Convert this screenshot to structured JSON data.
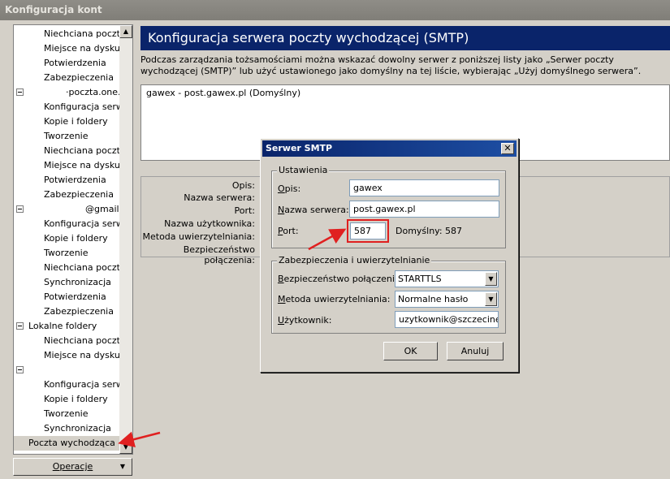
{
  "window": {
    "title": "Konfiguracja kont"
  },
  "sidebar": {
    "items": [
      {
        "label": "Niechciana poczta",
        "indent": 2,
        "expander": false
      },
      {
        "label": "Miejsce na dysku",
        "indent": 2,
        "expander": false
      },
      {
        "label": "Potwierdzenia",
        "indent": 2,
        "expander": false
      },
      {
        "label": "Zabezpieczenia",
        "indent": 2,
        "expander": false
      },
      {
        "label": "·poczta.one...",
        "indent": 3,
        "expander": true
      },
      {
        "label": "Konfiguracja serw...",
        "indent": 2,
        "expander": false
      },
      {
        "label": "Kopie i foldery",
        "indent": 2,
        "expander": false
      },
      {
        "label": "Tworzenie",
        "indent": 2,
        "expander": false
      },
      {
        "label": "Niechciana poczta",
        "indent": 2,
        "expander": false
      },
      {
        "label": "Miejsce na dysku",
        "indent": 2,
        "expander": false
      },
      {
        "label": "Potwierdzenia",
        "indent": 2,
        "expander": false
      },
      {
        "label": "Zabezpieczenia",
        "indent": 2,
        "expander": false
      },
      {
        "label": "@gmail.com",
        "indent": 4,
        "expander": true
      },
      {
        "label": "Konfiguracja serw...",
        "indent": 2,
        "expander": false
      },
      {
        "label": "Kopie i foldery",
        "indent": 2,
        "expander": false
      },
      {
        "label": "Tworzenie",
        "indent": 2,
        "expander": false
      },
      {
        "label": "Niechciana poczta",
        "indent": 2,
        "expander": false
      },
      {
        "label": "Synchronizacja",
        "indent": 2,
        "expander": false
      },
      {
        "label": "Potwierdzenia",
        "indent": 2,
        "expander": false
      },
      {
        "label": "Zabezpieczenia",
        "indent": 2,
        "expander": false
      },
      {
        "label": "Lokalne foldery",
        "indent": 1,
        "expander": true
      },
      {
        "label": "Niechciana poczta",
        "indent": 2,
        "expander": false
      },
      {
        "label": "Miejsce na dysku",
        "indent": 2,
        "expander": false
      },
      {
        "label": "",
        "indent": 1,
        "expander": true
      },
      {
        "label": "Konfiguracja serw...",
        "indent": 2,
        "expander": false
      },
      {
        "label": "Kopie i foldery",
        "indent": 2,
        "expander": false
      },
      {
        "label": "Tworzenie",
        "indent": 2,
        "expander": false
      },
      {
        "label": "Synchronizacja",
        "indent": 2,
        "expander": false
      },
      {
        "label": "Poczta wychodząca",
        "indent": 1,
        "expander": false,
        "selected": true
      }
    ],
    "operations_label": "Operacje"
  },
  "main": {
    "header": "Konfiguracja serwera poczty wychodzącej (SMTP)",
    "description": "Podczas zarządzania tożsamościami można wskazać dowolny serwer z poniższej listy jako „Serwer poczty wychodzącej (SMTP)” lub użyć ustawionego jako domyślny na tej liście, wybierając „Użyj domyślnego serwera”.",
    "server_list": [
      "gawex - post.gawex.pl (Domyślny)"
    ],
    "detail_labels": {
      "description": "Opis:",
      "server_name": "Nazwa serwera:",
      "port": "Port:",
      "username": "Nazwa użytkownika:",
      "auth_method": "Metoda uwierzytelniania:",
      "security": "Bezpieczeństwo połączenia:"
    }
  },
  "dialog": {
    "title": "Serwer SMTP",
    "settings_group": "Ustawienia",
    "description_label": "Opis:",
    "description_value": "gawex",
    "server_label": "Nazwa serwera:",
    "server_value": "post.gawex.pl",
    "port_label": "Port:",
    "port_value": "587",
    "default_label": "Domyślny:",
    "default_value": "587",
    "security_group": "Zabezpieczenia i uwierzytelnianie",
    "connection_security_label": "Bezpieczeństwo połączenia:",
    "connection_security_value": "STARTTLS",
    "auth_method_label": "Metoda uwierzytelniania:",
    "auth_method_value": "Normalne hasło",
    "user_label": "Użytkownik:",
    "user_value": "uzytkownik@szczecinek.c",
    "ok_label": "OK",
    "cancel_label": "Anuluj"
  },
  "colors": {
    "header_bg": "#0a246a",
    "annotation_red": "#e02020"
  }
}
